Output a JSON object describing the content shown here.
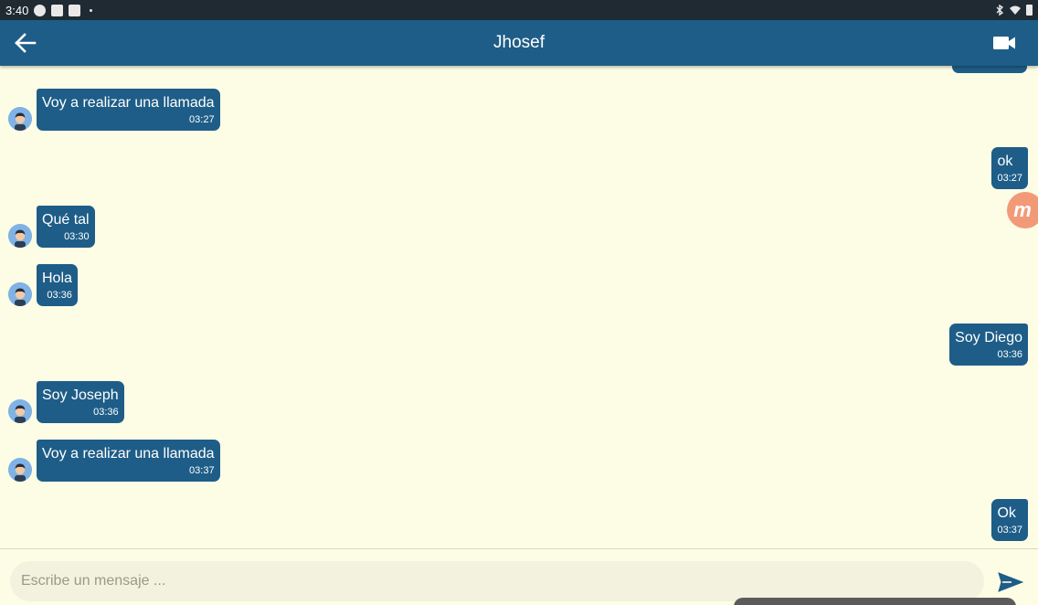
{
  "status_bar": {
    "time": "3:40"
  },
  "header": {
    "title": "Jhosef"
  },
  "messages": [
    {
      "direction": "in",
      "text": "Voy a realizar una llamada",
      "time": "03:27"
    },
    {
      "direction": "out",
      "text": "ok",
      "time": "03:27"
    },
    {
      "direction": "in",
      "text": "Qué tal",
      "time": "03:30"
    },
    {
      "direction": "in",
      "text": "Hola",
      "time": "03:36"
    },
    {
      "direction": "out",
      "text": "Soy Diego",
      "time": "03:36"
    },
    {
      "direction": "in",
      "text": "Soy Joseph",
      "time": "03:36"
    },
    {
      "direction": "in",
      "text": "Voy a realizar una llamada",
      "time": "03:37"
    },
    {
      "direction": "out",
      "text": "Ok",
      "time": "03:37"
    }
  ],
  "composer": {
    "placeholder": "Escribe un mensaje ..."
  },
  "colors": {
    "bubble": "#1e5d87",
    "app_bar": "#1e5d87",
    "background": "#fdfde6",
    "status_bar": "#1f2a33"
  },
  "icons": {
    "back": "arrow-left-icon",
    "video": "video-camera-icon",
    "send": "send-icon",
    "avatar": "user-avatar-icon"
  }
}
